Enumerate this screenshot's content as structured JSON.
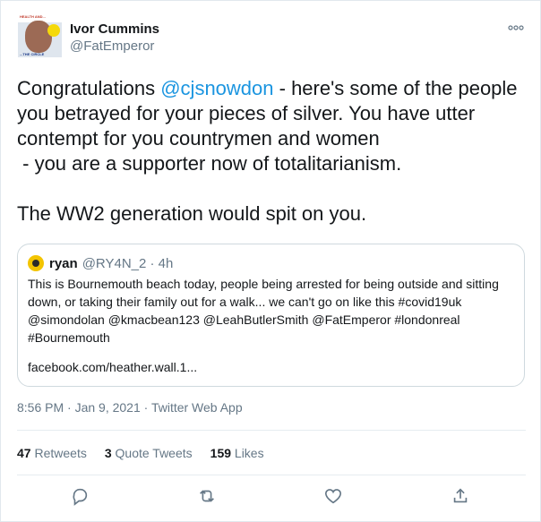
{
  "author": {
    "name": "Ivor Cummins",
    "handle": "@FatEmperor",
    "avatar_text_top": "HEALTH AND...",
    "avatar_text_bottom": "...THE CIRCLE"
  },
  "more_icon": "more-dots-icon",
  "tweet": {
    "text_before_mention": "Congratulations ",
    "mention": "@cjsnowdon",
    "text_after_mention": " - here's some of the people you betrayed for your pieces of silver. You have utter contempt for you countrymen and women\n - you are a supporter now of totalitarianism.\n\nThe WW2 generation would spit on you."
  },
  "quoted": {
    "name": "ryan",
    "handle_time": "@RY4N_2 · 4h",
    "text": "This is Bournemouth beach today, people being arrested for being outside and sitting down, or taking their family out for a walk... we can't go on like this #covid19uk @simondolan @kmacbean123 @LeahButlerSmith @FatEmperor #londonreal #Bournemouth",
    "link": "facebook.com/heather.wall.1..."
  },
  "meta": {
    "time": "8:56 PM · Jan 9, 2021 · Twitter Web App"
  },
  "stats": {
    "retweets_count": "47",
    "retweets_label": "Retweets",
    "quotes_count": "3",
    "quotes_label": "Quote Tweets",
    "likes_count": "159",
    "likes_label": "Likes"
  },
  "actions": [
    "reply-icon",
    "retweet-icon",
    "like-icon",
    "share-icon"
  ],
  "colors": {
    "link": "#1b95e0",
    "secondary": "#657786",
    "border": "#e6ecf0"
  }
}
